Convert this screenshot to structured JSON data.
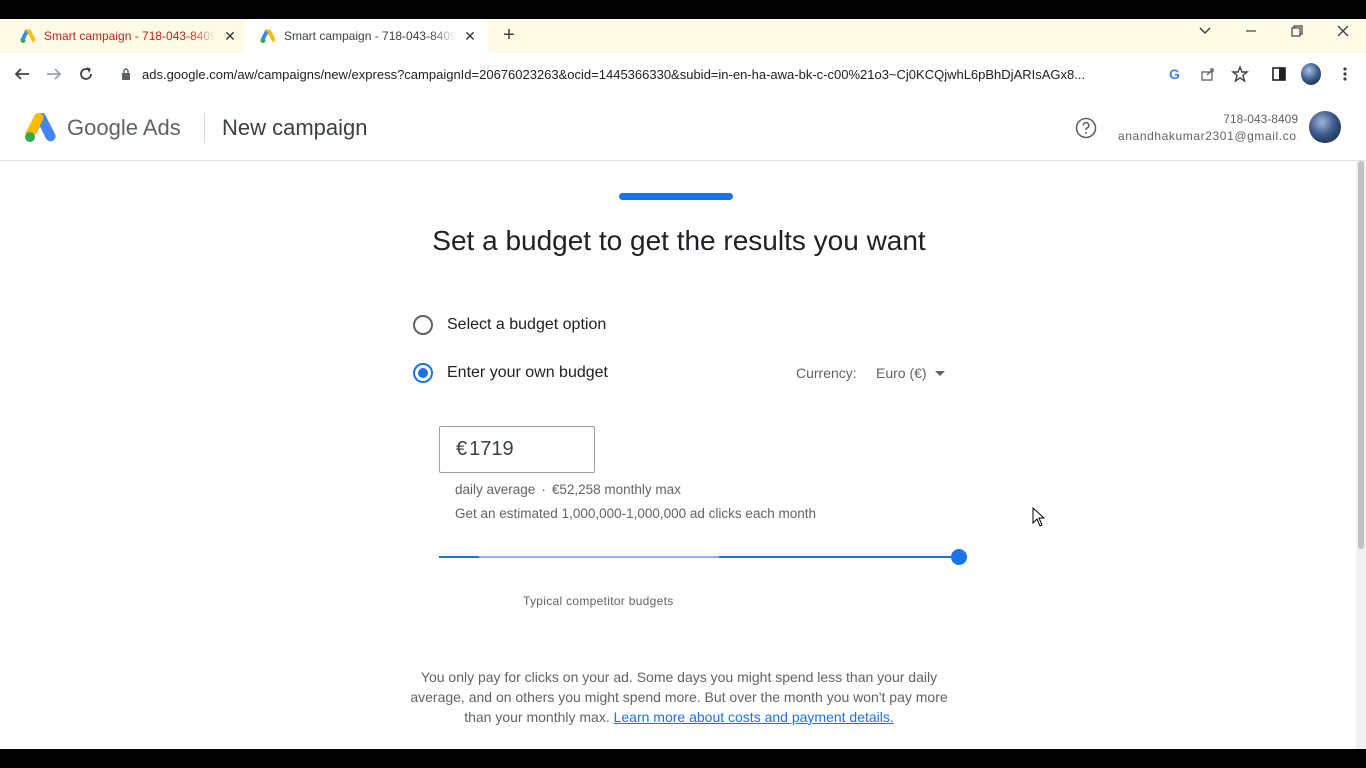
{
  "browser": {
    "tabs": [
      {
        "title": "Smart campaign - 718-043-8409",
        "active": false
      },
      {
        "title": "Smart campaign - 718-043-8409",
        "active": true
      }
    ],
    "url": "ads.google.com/aw/campaigns/new/express?campaignId=20676023263&ocid=1445366330&subid=in-en-ha-awa-bk-c-c00%21o3~Cj0KCQjwhL6pBhDjARIsAGx8..."
  },
  "appbar": {
    "brand_google": "Google",
    "brand_ads": "Ads",
    "page_title": "New campaign",
    "account_id": "718-043-8409",
    "account_email": "anandhakumar2301@gmail.co..."
  },
  "main": {
    "headline": "Set a budget to get the results you want",
    "option_select": "Select a budget option",
    "option_own": "Enter your own budget",
    "selected_option": "own",
    "currency_label": "Currency:",
    "currency_value": "Euro (€)",
    "budget_symbol": "€",
    "budget_value": "1719",
    "daily_average": "daily average",
    "separator": "·",
    "monthly_max": "€52,258 monthly max",
    "estimate": "Get an estimated 1,000,000-1,000,000 ad clicks each month",
    "slider_position_fraction": 1.0,
    "competitor_label": "Typical competitor budgets",
    "pay_note": "You only pay for clicks on your ad. Some days you might spend less than your daily average, and on others you might spend more. But over the month you won't pay more than your monthly max.",
    "learn_more": "Learn more about costs and payment details."
  },
  "colors": {
    "accent": "#1a73e8",
    "tabstrip": "#fdfbe6",
    "text_secondary": "#5f6368"
  },
  "icons": [
    "google-ads-logo",
    "help-icon",
    "back-icon",
    "forward-icon",
    "reload-icon",
    "lock-icon",
    "google-lens-icon",
    "share-icon",
    "star-icon",
    "sidepanel-icon",
    "menu-icon",
    "close-icon",
    "plus-icon",
    "minimize-icon",
    "restore-icon",
    "tab-search-icon"
  ]
}
